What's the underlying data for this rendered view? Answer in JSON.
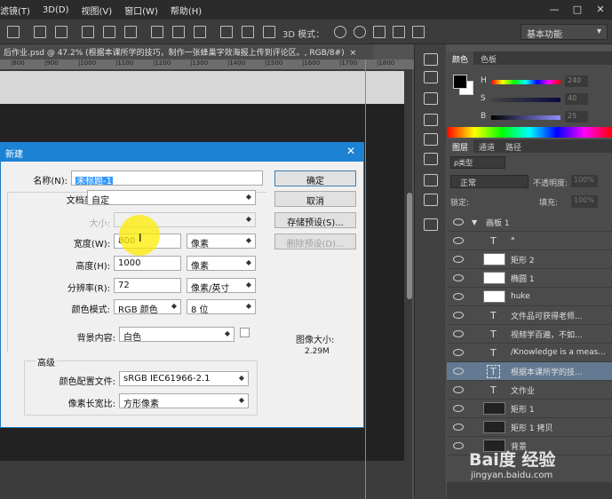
{
  "menubar": {
    "items": [
      "滤镜(T)",
      "3D(D)",
      "视图(V)",
      "窗口(W)",
      "帮助(H)"
    ],
    "window_controls": [
      "—",
      "□",
      "✕"
    ]
  },
  "options_bar": {
    "mode_3d_label": "3D 模式：",
    "workspace": "基本功能"
  },
  "document_tab": {
    "title": "后作业.psd @ 47.2% (根据本课所学的技巧，制作一张蜂巢字效海报上传到评论区。, RGB/8#)",
    "close": "×"
  },
  "ruler": {
    "ticks": [
      "|800",
      "|900",
      "|1000",
      "|1100",
      "|1200",
      "|1300",
      "|1400",
      "|1500",
      "|1600",
      "|1700",
      "|1800"
    ]
  },
  "color_panel": {
    "tabs": [
      "颜色",
      "色板"
    ],
    "channels": [
      {
        "label": "H",
        "value": "240",
        "unit": "°"
      },
      {
        "label": "S",
        "value": "40",
        "unit": "%"
      },
      {
        "label": "B",
        "value": "25",
        "unit": "%"
      }
    ],
    "fg_color": "#000000",
    "bg_color": "#ffffff"
  },
  "layers_panel": {
    "tabs": [
      "图层",
      "通道",
      "路径"
    ],
    "filter_type": "ρ类型",
    "blend_mode": "正常",
    "opacity_label": "不透明度:",
    "opacity_value": "100%",
    "lock_label": "锁定:",
    "fill_label": "填充:",
    "fill_value": "100%",
    "layers": [
      {
        "name": "画板 1",
        "kind": "group"
      },
      {
        "name": "*",
        "kind": "text"
      },
      {
        "name": "矩形 2",
        "kind": "shape"
      },
      {
        "name": "椭圆 1",
        "kind": "shape"
      },
      {
        "name": "huke",
        "kind": "shape"
      },
      {
        "name": "文件品可获得老师...",
        "kind": "text"
      },
      {
        "name": "视频学百遍，不如...",
        "kind": "text"
      },
      {
        "name": "/Knowledge is a meas...",
        "kind": "text"
      },
      {
        "name": "根据本课所学的技...",
        "kind": "text",
        "selected": true
      },
      {
        "name": "文作业",
        "kind": "text"
      },
      {
        "name": "矩形 1",
        "kind": "shape-dark"
      },
      {
        "name": "矩形 1 拷贝",
        "kind": "shape-dark"
      },
      {
        "name": "背景",
        "kind": "bg"
      }
    ]
  },
  "new_dialog": {
    "title": "新建",
    "close": "✕",
    "name_label": "名称(N):",
    "name_value": "未标题-1",
    "doc_type_label": "文档类型:",
    "doc_type_value": "自定",
    "size_label": "大小:",
    "width_label": "宽度(W):",
    "width_value": "800",
    "width_unit": "像素",
    "height_label": "高度(H):",
    "height_value": "1000",
    "height_unit": "像素",
    "resolution_label": "分辨率(R):",
    "resolution_value": "72",
    "resolution_unit": "像素/英寸",
    "color_mode_label": "颜色模式:",
    "color_mode_value": "RGB 颜色",
    "bit_depth": "8 位",
    "bg_label": "背景内容:",
    "bg_value": "白色",
    "advanced_label": "高级",
    "profile_label": "颜色配置文件:",
    "profile_value": "sRGB IEC61966-2.1",
    "aspect_label": "像素长宽比:",
    "aspect_value": "方形像素",
    "image_size_label": "图像大小:",
    "image_size_value": "2.29M",
    "buttons": {
      "ok": "确定",
      "cancel": "取消",
      "save_preset": "存储预设(S)...",
      "delete_preset": "删除预设(D)..."
    }
  },
  "watermark": {
    "brand": "Bai度 经验",
    "url": "jingyan.baidu.com"
  },
  "colors": {
    "dialog_title": "#1c82d4",
    "selection": "#3399ff",
    "guide": "#39a7d8",
    "layer_selected": "#627991"
  }
}
